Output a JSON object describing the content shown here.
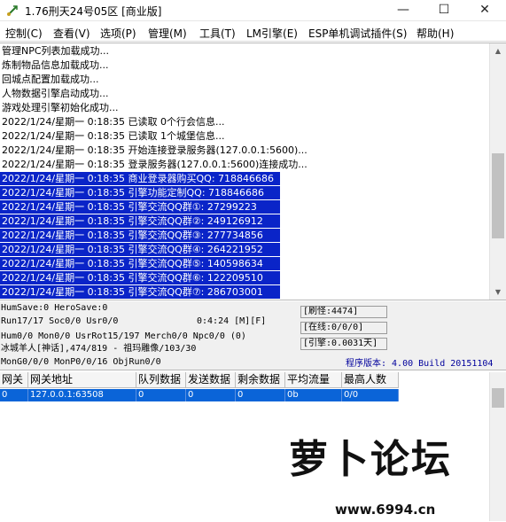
{
  "window": {
    "title": "1.76刑天24号05区 [商业版]",
    "minimize_glyph": "—",
    "maximize_glyph": "☐",
    "close_glyph": "✕"
  },
  "menu": [
    "控制(C)",
    "查看(V)",
    "选项(P)",
    "管理(M)",
    "工具(T)",
    "LM引擎(E)",
    "ESP单机调试插件(S)",
    "帮助(H)"
  ],
  "log": {
    "lines": [
      {
        "text": "管理NPC列表加载成功...",
        "selected": false
      },
      {
        "text": "炼制物品信息加载成功...",
        "selected": false
      },
      {
        "text": "回城点配置加载成功...",
        "selected": false
      },
      {
        "text": "人物数据引擎启动成功...",
        "selected": false
      },
      {
        "text": "游戏处理引擎初始化成功...",
        "selected": false
      },
      {
        "text": "2022/1/24/星期一 0:18:35 已读取 0个行会信息...",
        "selected": false
      },
      {
        "text": "2022/1/24/星期一 0:18:35 已读取 1个城堡信息...",
        "selected": false
      },
      {
        "text": "2022/1/24/星期一 0:18:35 开始连接登录服务器(127.0.0.1:5600)...",
        "selected": false
      },
      {
        "text": "2022/1/24/星期一 0:18:35 登录服务器(127.0.0.1:5600)连接成功...",
        "selected": false
      },
      {
        "text": "2022/1/24/星期一 0:18:35 商业登录器购买QQ: 718846686",
        "selected": true
      },
      {
        "text": "2022/1/24/星期一 0:18:35 引擎功能定制QQ: 718846686",
        "selected": true
      },
      {
        "text": "2022/1/24/星期一 0:18:35 引擎交流QQ群①: 27299223",
        "selected": true
      },
      {
        "text": "2022/1/24/星期一 0:18:35 引擎交流QQ群②: 249126912",
        "selected": true
      },
      {
        "text": "2022/1/24/星期一 0:18:35 引擎交流QQ群③: 277734856",
        "selected": true
      },
      {
        "text": "2022/1/24/星期一 0:18:35 引擎交流QQ群④: 264221952",
        "selected": true
      },
      {
        "text": "2022/1/24/星期一 0:18:35 引擎交流QQ群⑤: 140598634",
        "selected": true
      },
      {
        "text": "2022/1/24/星期一 0:18:35 引擎交流QQ群⑥: 122209510",
        "selected": true
      },
      {
        "text": "2022/1/24/星期一 0:18:35 引擎交流QQ群⑦: 286703001",
        "selected": true
      }
    ]
  },
  "status": {
    "line1": "HumSave:0 HeroSave:0",
    "line2_left": "Run17/17 Soc0/0 Usr0/0",
    "line2_time": "0:4:24 [M][F]",
    "line3": "Hum0/0 Mon0/0 UsrRot15/197 Merch0/0 Npc0/0 (0)",
    "line4": "冰城羊人[神话],474/819 - 祖玛雕像/103/30",
    "line5": "MonG0/0/0 MonP0/0/16 ObjRun0/0",
    "monsters": "[刷怪:4474]",
    "online": "[在线:0/0/0]",
    "engine": "[引擎:0.0031天]",
    "version": "程序版本: 4.00 Build 20151104"
  },
  "gateway_table": {
    "headers": [
      "网关",
      "网关地址",
      "队列数据",
      "发送数据",
      "剩余数据",
      "平均流量",
      "最高人数"
    ],
    "rows": [
      [
        "0",
        "127.0.0.1:63508",
        "0",
        "0",
        "0",
        "0b",
        "0/0"
      ]
    ]
  },
  "watermark": {
    "text": "萝卜论坛",
    "url": "www.6994.cn"
  },
  "colors": {
    "selection": "#0a24c8",
    "grid_selection": "#0a64d8",
    "version_text": "#00009c"
  }
}
